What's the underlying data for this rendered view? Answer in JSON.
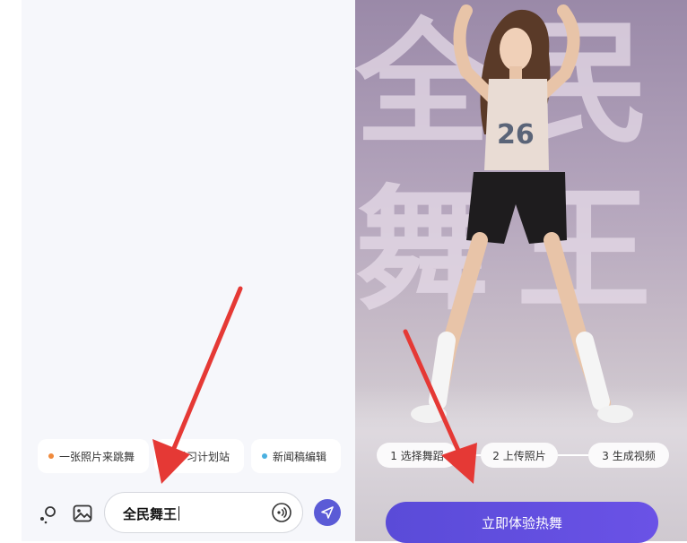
{
  "left": {
    "chips": [
      {
        "label": "一张照片来跳舞",
        "dot": "#f08a3c"
      },
      {
        "label": "学习计划站",
        "dot": "#f0c040"
      },
      {
        "label": "新闻稿编辑",
        "dot": "#4ab0e0"
      }
    ],
    "input": {
      "value": "全民舞王"
    },
    "icons": [
      "sparkle-icon",
      "image-icon",
      "voice-icon",
      "send-icon"
    ]
  },
  "right": {
    "background_text": [
      "全民",
      "舞王"
    ],
    "steps": [
      "1 选择舞蹈",
      "2 上传照片",
      "3 生成视频"
    ],
    "cta_label": "立即体验热舞"
  },
  "colors": {
    "accent": "#5b5bd6",
    "arrow": "#e53935"
  }
}
